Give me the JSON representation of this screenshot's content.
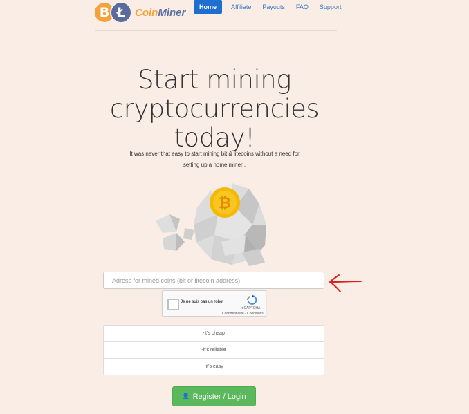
{
  "brand": {
    "name_part1": "Coin",
    "name_part2": "Miner",
    "btc_glyph": "B",
    "ltc_glyph": "Ł"
  },
  "nav": {
    "items": [
      {
        "label": "Home",
        "active": true
      },
      {
        "label": "Affiliate"
      },
      {
        "label": "Payouts"
      },
      {
        "label": "FAQ"
      },
      {
        "label": "Support"
      }
    ]
  },
  "hero": {
    "title_line1": "Start mining",
    "title_line2": "cryptocurrencies",
    "title_line3": "today!",
    "subtitle_line1": "It was never that easy to start mining bit & litecoins without a need for",
    "subtitle_line2": "setting up a home miner ."
  },
  "form": {
    "address_placeholder": "Adress for mined coins (bit or litecoin address)",
    "captcha_label": "Je ne suis pas un robot",
    "captcha_brand": "reCAPTCHA",
    "captcha_links": "Confidentialité - Conditions"
  },
  "features": [
    "-it's cheap",
    "-it's reliable",
    "-it's easy"
  ],
  "register_label": "Register / Login",
  "colors": {
    "accent": "#1f6fd1",
    "btc": "#f4a23a",
    "ltc": "#5a6c9c",
    "success": "#5cb85c",
    "annotation": "#e0201b"
  }
}
